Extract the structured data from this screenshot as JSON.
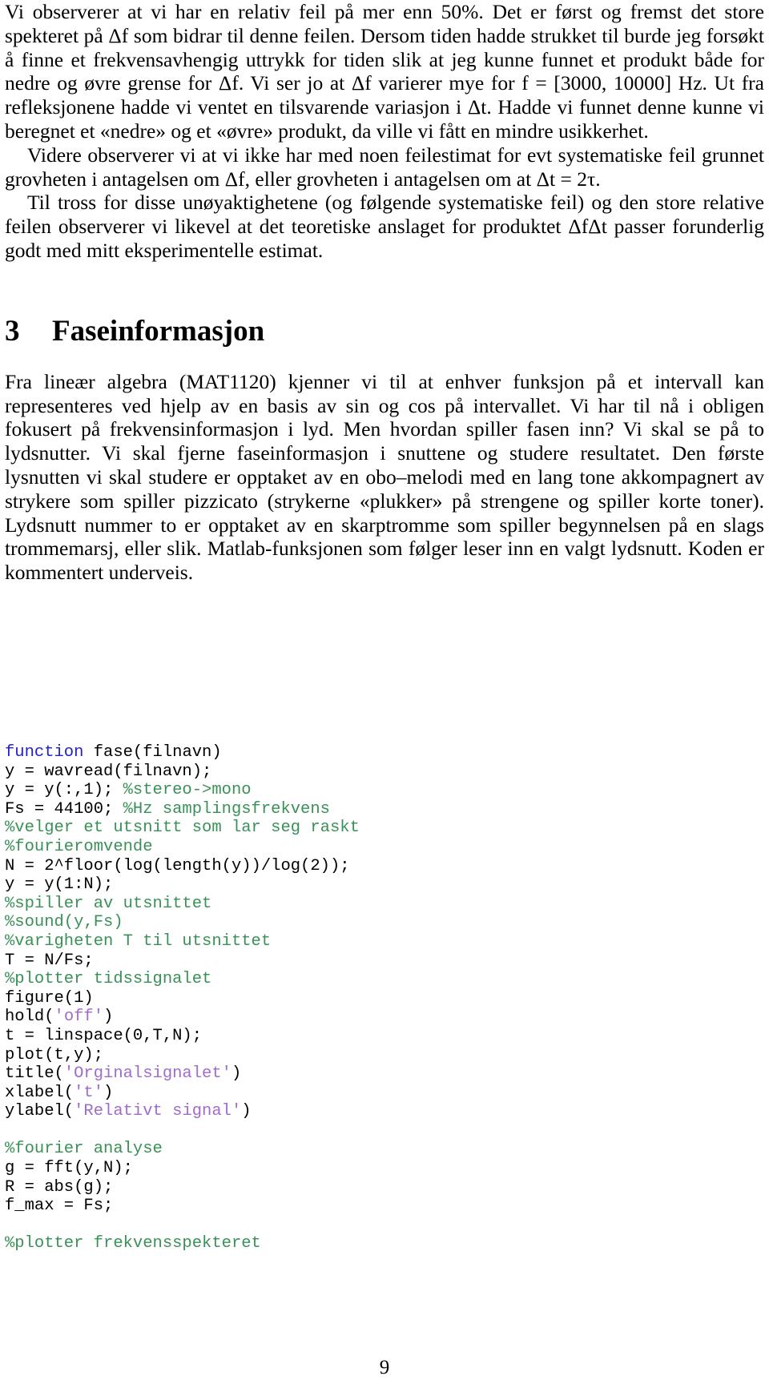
{
  "document": {
    "page_number": "9",
    "paragraphs": [
      {
        "id": "p1",
        "indent": false,
        "text": "Vi observerer at vi har en relativ feil på mer enn 50%. Det er først og fremst det store spekteret på Δf som bidrar til denne feilen. Dersom tiden hadde strukket til burde jeg forsøkt å finne et frekvensavhengig uttrykk for tiden slik at jeg kunne funnet et produkt både for nedre og øvre grense for Δf. Vi ser jo at Δf varierer mye for f = [3000, 10000] Hz. Ut fra refleksjonene hadde vi ventet en tilsvarende variasjon i Δt. Hadde vi funnet denne kunne vi beregnet et «nedre» og et «øvre» produkt, da ville vi fått en mindre usikkerhet."
      },
      {
        "id": "p2",
        "indent": true,
        "text": "Videre observerer vi at vi ikke har med noen feilestimat for evt systematiske feil grunnet grovheten i antagelsen om Δf, eller grovheten i antagelsen om at Δt = 2τ."
      },
      {
        "id": "p3",
        "indent": true,
        "text": "Til tross for disse unøyaktighetene (og følgende systematiske feil) og den store relative feilen observerer vi likevel at det teoretiske anslaget for produktet ΔfΔt passer forunderlig godt med mitt eksperimentelle estimat."
      }
    ],
    "section": {
      "number": "3",
      "title": "Faseinformasjon"
    },
    "paragraphs_after_section": [
      {
        "id": "p4",
        "indent": false,
        "text": "Fra lineær algebra (MAT1120) kjenner vi til at enhver funksjon på et intervall kan representeres ved hjelp av en basis av sin og cos på intervallet. Vi har til nå i obligen fokusert på frekvensinformasjon i lyd. Men hvordan spiller fasen inn? Vi skal se på to lydsnutter. Vi skal fjerne faseinformasjon i snuttene og studere resultatet. Den første lysnutten vi skal studere er opptaket av en obo–melodi med en lang tone akkompagnert av strykere som spiller pizzicato (strykerne «plukker» på strengene og spiller korte toner). Lydsnutt nummer to er opptaket av en skarptromme som spiller begynnelsen på en slags trommemarsj, eller slik. Matlab-funksjonen som følger leser inn en valgt lydsnutt. Koden er kommentert underveis."
      }
    ],
    "code": {
      "language": "matlab",
      "colors": {
        "keyword": "#2222cc",
        "comment": "#3a9157",
        "string": "#a06ccc",
        "plain": "#000000"
      },
      "lines": [
        [
          {
            "t": "function",
            "c": "kw"
          },
          {
            "t": " fase(filnavn)",
            "c": "pl"
          }
        ],
        [
          {
            "t": "y = wavread(filnavn);",
            "c": "pl"
          }
        ],
        [
          {
            "t": "y = y(:,1); ",
            "c": "pl"
          },
          {
            "t": "%stereo->mono",
            "c": "cm"
          }
        ],
        [
          {
            "t": "Fs = 44100; ",
            "c": "pl"
          },
          {
            "t": "%Hz samplingsfrekvens",
            "c": "cm"
          }
        ],
        [
          {
            "t": "%velger et utsnitt som lar seg raskt",
            "c": "cm"
          }
        ],
        [
          {
            "t": "%fourieromvende",
            "c": "cm"
          }
        ],
        [
          {
            "t": "N = 2^floor(log(length(y))/log(2));",
            "c": "pl"
          }
        ],
        [
          {
            "t": "y = y(1:N);",
            "c": "pl"
          }
        ],
        [
          {
            "t": "%spiller av utsnittet",
            "c": "cm"
          }
        ],
        [
          {
            "t": "%sound(y,Fs)",
            "c": "cm"
          }
        ],
        [
          {
            "t": "%varigheten T til utsnittet",
            "c": "cm"
          }
        ],
        [
          {
            "t": "T = N/Fs;",
            "c": "pl"
          }
        ],
        [
          {
            "t": "%plotter tidssignalet",
            "c": "cm"
          }
        ],
        [
          {
            "t": "figure(1)",
            "c": "pl"
          }
        ],
        [
          {
            "t": "hold(",
            "c": "pl"
          },
          {
            "t": "'off'",
            "c": "st"
          },
          {
            "t": ")",
            "c": "pl"
          }
        ],
        [
          {
            "t": "t = linspace(0,T,N);",
            "c": "pl"
          }
        ],
        [
          {
            "t": "plot(t,y);",
            "c": "pl"
          }
        ],
        [
          {
            "t": "title(",
            "c": "pl"
          },
          {
            "t": "'Orginalsignalet'",
            "c": "st"
          },
          {
            "t": ")",
            "c": "pl"
          }
        ],
        [
          {
            "t": "xlabel(",
            "c": "pl"
          },
          {
            "t": "'t'",
            "c": "st"
          },
          {
            "t": ")",
            "c": "pl"
          }
        ],
        [
          {
            "t": "ylabel(",
            "c": "pl"
          },
          {
            "t": "'Relativt signal'",
            "c": "st"
          },
          {
            "t": ")",
            "c": "pl"
          }
        ],
        [
          {
            "t": "",
            "c": "pl"
          }
        ],
        [
          {
            "t": "%fourier analyse",
            "c": "cm"
          }
        ],
        [
          {
            "t": "g = fft(y,N);",
            "c": "pl"
          }
        ],
        [
          {
            "t": "R = abs(g);",
            "c": "pl"
          }
        ],
        [
          {
            "t": "f_max = Fs;",
            "c": "pl"
          }
        ],
        [
          {
            "t": "",
            "c": "pl"
          }
        ],
        [
          {
            "t": "%plotter frekvensspekteret",
            "c": "cm"
          }
        ]
      ]
    }
  }
}
